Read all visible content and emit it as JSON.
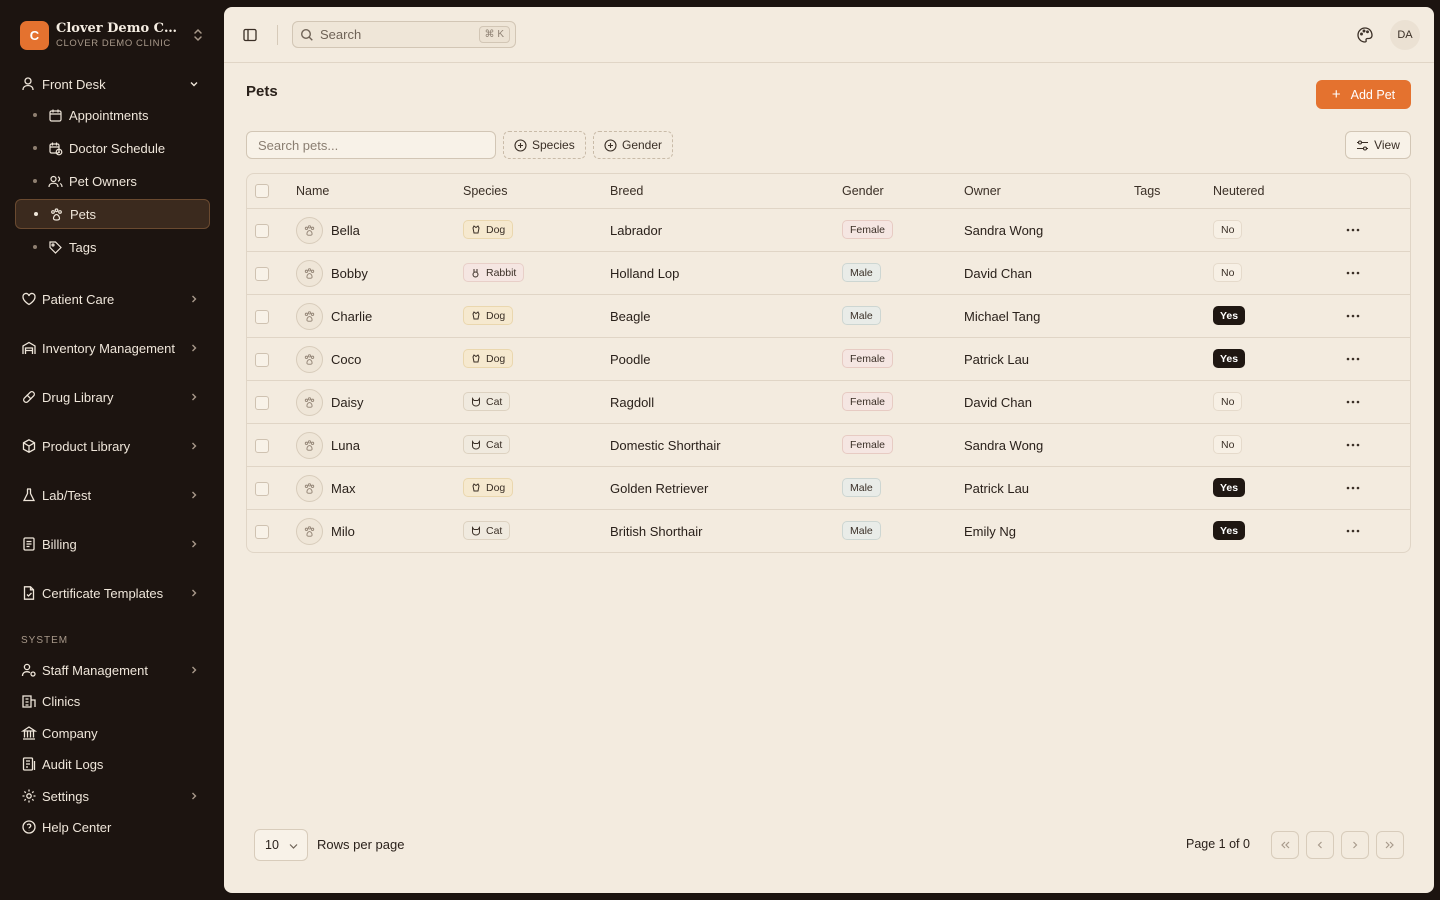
{
  "app": {
    "logo_letter": "C",
    "clinic_name": "Clover Demo Clinic",
    "clinic_sub": "CLOVER DEMO CLINIC",
    "accent": "#e4722f"
  },
  "sidebar": {
    "front_desk": "Front Desk",
    "sub_items": [
      {
        "label": "Appointments",
        "icon": "calendar-icon"
      },
      {
        "label": "Doctor Schedule",
        "icon": "calendar-clock-icon"
      },
      {
        "label": "Pet Owners",
        "icon": "users-icon"
      },
      {
        "label": "Pets",
        "icon": "paw-icon",
        "active": true
      },
      {
        "label": "Tags",
        "icon": "tag-icon"
      }
    ],
    "groups": [
      {
        "label": "Patient Care",
        "icon": "heart-icon"
      },
      {
        "label": "Inventory Management",
        "icon": "warehouse-icon"
      },
      {
        "label": "Drug Library",
        "icon": "pill-icon"
      },
      {
        "label": "Product Library",
        "icon": "package-icon"
      },
      {
        "label": "Lab/Test",
        "icon": "flask-icon"
      },
      {
        "label": "Billing",
        "icon": "receipt-icon"
      },
      {
        "label": "Certificate Templates",
        "icon": "file-icon"
      }
    ],
    "system_label": "SYSTEM",
    "system_items": [
      {
        "label": "Staff Management",
        "icon": "users-cog-icon"
      },
      {
        "label": "Clinics",
        "icon": "building-icon"
      },
      {
        "label": "Company",
        "icon": "landmark-icon"
      },
      {
        "label": "Audit Logs",
        "icon": "logs-icon"
      },
      {
        "label": "Settings",
        "icon": "gear-icon"
      },
      {
        "label": "Help Center",
        "icon": "help-icon"
      }
    ]
  },
  "topbar": {
    "search_placeholder": "Search",
    "search_shortcut": "⌘ K",
    "avatar_initials": "DA"
  },
  "page": {
    "title": "Pets",
    "add_button": "Add Pet",
    "filter_placeholder": "Search pets...",
    "species_filter": "Species",
    "gender_filter": "Gender",
    "view_button": "View"
  },
  "table": {
    "columns": [
      "Name",
      "Species",
      "Breed",
      "Gender",
      "Owner",
      "Tags",
      "Neutered"
    ],
    "rows": [
      {
        "name": "Bella",
        "species": "Dog",
        "breed": "Labrador",
        "gender": "Female",
        "owner": "Sandra Wong",
        "tags": "",
        "neutered": "No"
      },
      {
        "name": "Bobby",
        "species": "Rabbit",
        "breed": "Holland Lop",
        "gender": "Male",
        "owner": "David Chan",
        "tags": "",
        "neutered": "No"
      },
      {
        "name": "Charlie",
        "species": "Dog",
        "breed": "Beagle",
        "gender": "Male",
        "owner": "Michael Tang",
        "tags": "",
        "neutered": "Yes"
      },
      {
        "name": "Coco",
        "species": "Dog",
        "breed": "Poodle",
        "gender": "Female",
        "owner": "Patrick Lau",
        "tags": "",
        "neutered": "Yes"
      },
      {
        "name": "Daisy",
        "species": "Cat",
        "breed": "Ragdoll",
        "gender": "Female",
        "owner": "David Chan",
        "tags": "",
        "neutered": "No"
      },
      {
        "name": "Luna",
        "species": "Cat",
        "breed": "Domestic Shorthair",
        "gender": "Female",
        "owner": "Sandra Wong",
        "tags": "",
        "neutered": "No"
      },
      {
        "name": "Max",
        "species": "Dog",
        "breed": "Golden Retriever",
        "gender": "Male",
        "owner": "Patrick Lau",
        "tags": "",
        "neutered": "Yes"
      },
      {
        "name": "Milo",
        "species": "Cat",
        "breed": "British Shorthair",
        "gender": "Male",
        "owner": "Emily Ng",
        "tags": "",
        "neutered": "Yes"
      }
    ]
  },
  "pagination": {
    "rows_per_page_value": "10",
    "rows_per_page_label": "Rows per page",
    "page_info": "Page 1 of 0"
  }
}
